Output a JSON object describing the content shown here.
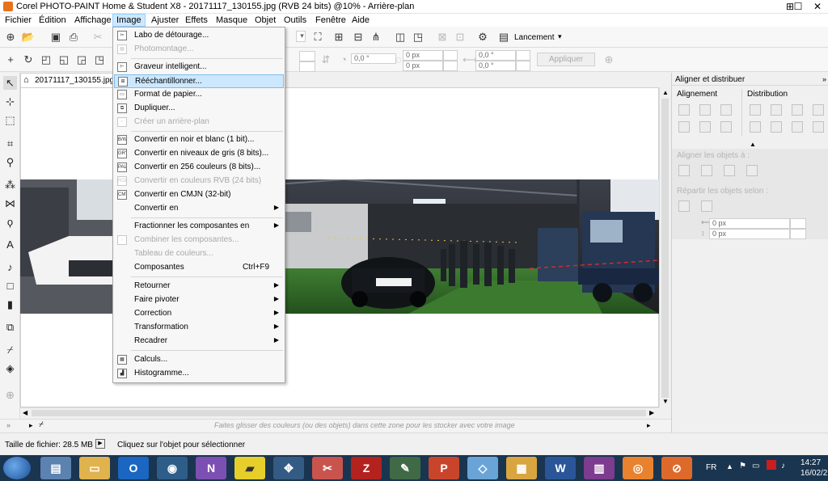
{
  "window": {
    "title": "Corel PHOTO-PAINT Home & Student X8 - 20171117_130155.jpg (RVB 24 bits) @10% - Arrière-plan",
    "minimize": "—",
    "maximize": "☐",
    "close": "✕"
  },
  "menubar": {
    "items": [
      "Fichier",
      "Édition",
      "Affichage",
      "Image",
      "Ajuster",
      "Effets",
      "Masque",
      "Objet",
      "Outils",
      "Fenêtre",
      "Aide"
    ],
    "active": "Image"
  },
  "toolbar": {
    "launch_label": "Lancement",
    "apply_label": "Appliquer",
    "angle1": "0,0 °",
    "offset_x": "0 px",
    "offset_y": "0 px",
    "angle2": "0,0 °",
    "angle3": "0,0 °"
  },
  "document": {
    "tab_label": "20171117_130155.jpg"
  },
  "image_menu": {
    "items": [
      {
        "label": "Labo de détourage...",
        "icon": "cutout-icon",
        "enabled": true
      },
      {
        "label": "Photomontage...",
        "icon": "photomontage-icon",
        "enabled": false
      },
      {
        "separator": true
      },
      {
        "label": "Graveur intelligent...",
        "icon": "smart-carver-icon",
        "enabled": true
      },
      {
        "label": "Rééchantillonner...",
        "icon": "resample-icon",
        "enabled": true,
        "highlighted": true
      },
      {
        "label": "Format de papier...",
        "icon": "paper-size-icon",
        "enabled": true
      },
      {
        "label": "Dupliquer...",
        "icon": "duplicate-icon",
        "enabled": true
      },
      {
        "label": "Créer un arrière-plan",
        "icon": "create-background-icon",
        "enabled": false
      },
      {
        "separator": true
      },
      {
        "label": "Convertir en noir et blanc (1 bit)...",
        "icon": "bw-icon",
        "icon_text": "B/W",
        "enabled": true
      },
      {
        "label": "Convertir en niveaux de gris (8 bits)...",
        "icon": "grayscale-icon",
        "icon_text": "GRY",
        "enabled": true
      },
      {
        "label": "Convertir en 256 couleurs (8 bits)...",
        "icon": "palette-icon",
        "icon_text": "PAL",
        "enabled": true
      },
      {
        "label": "Convertir en couleurs RVB (24 bits)",
        "icon": "rgb-icon",
        "icon_text": "RGB",
        "enabled": false
      },
      {
        "label": "Convertir en CMJN (32-bit)",
        "icon": "cmyk-icon",
        "icon_text": "CMY",
        "enabled": true
      },
      {
        "label": "Convertir en",
        "submenu": true,
        "enabled": true
      },
      {
        "separator": true
      },
      {
        "label": "Fractionner les composantes en",
        "submenu": true,
        "enabled": true
      },
      {
        "label": "Combiner les composantes...",
        "icon": "combine-icon",
        "enabled": false
      },
      {
        "label": "Tableau de couleurs...",
        "enabled": false
      },
      {
        "label": "Composantes",
        "shortcut": "Ctrl+F9",
        "enabled": true
      },
      {
        "separator": true
      },
      {
        "label": "Retourner",
        "submenu": true,
        "enabled": true
      },
      {
        "label": "Faire pivoter",
        "submenu": true,
        "enabled": true
      },
      {
        "label": "Correction",
        "submenu": true,
        "enabled": true
      },
      {
        "label": "Transformation",
        "submenu": true,
        "enabled": true
      },
      {
        "label": "Recadrer",
        "submenu": true,
        "enabled": true
      },
      {
        "separator": true
      },
      {
        "label": "Calculs...",
        "icon": "calculator-icon",
        "enabled": true
      },
      {
        "label": "Histogramme...",
        "icon": "histogram-icon",
        "enabled": true
      }
    ]
  },
  "docker": {
    "title": "Aligner et distribuer",
    "align_label": "Alignement",
    "distribute_label": "Distribution",
    "align_to_label": "Aligner les objets à :",
    "spread_label": "Répartir les objets selon :",
    "spacing_h": "0 px",
    "spacing_v": "0 px"
  },
  "status": {
    "color_hint": "Faites glisser des couleurs (ou des objets) dans cette zone pour les stocker avec votre image",
    "file_size": "Taille de fichier: 28.5 MB",
    "message": "Cliquez sur l'objet pour sélectionner"
  },
  "taskbar": {
    "apps": [
      "calculator-icon",
      "file-explorer-icon",
      "outlook-icon",
      "chrome-icon",
      "nvu-icon",
      "sticky-notes-icon",
      "move-icon",
      "snipping-icon",
      "filezilla-icon",
      "photo-paint-icon",
      "powerpoint-icon",
      "sheet-icon",
      "project-icon",
      "word-icon",
      "winrar-icon",
      "app-icon",
      "app2-icon"
    ],
    "language": "FR",
    "time": "14:27",
    "date": "16/02/2"
  },
  "colors": {
    "accent": "#cce8ff",
    "taskbar": "#1a3550",
    "photo_floor": "#2e6a26",
    "photo_roof": "#4a4f57"
  }
}
